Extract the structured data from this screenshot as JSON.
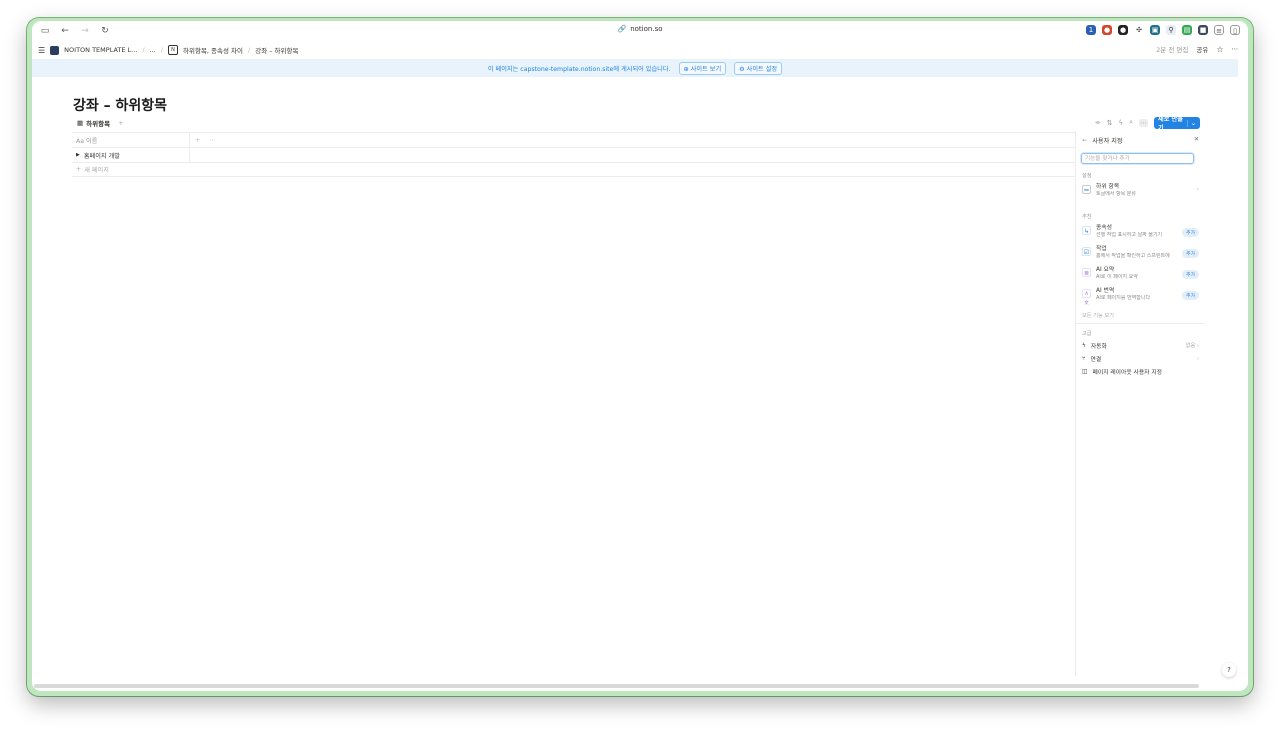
{
  "browser": {
    "url": "notion.so",
    "url_icon": "link-icon"
  },
  "header": {
    "workspace": "NOITON TEMPLATE L...",
    "ellipsis": "...",
    "crumb_parent": "하위항목, 종속성 차이",
    "crumb_current": "강좌 – 하위항목",
    "edited": "2분 전 편집",
    "share": "공유"
  },
  "banner": {
    "text": "이 페이지는 capstone-template.notion.site에 게시되어 있습니다.",
    "view_site": "사이트 보기",
    "site_settings": "사이트 설정"
  },
  "page": {
    "title": "강좌 – 하위항목",
    "view_tab": "하위항목",
    "add_view": "+",
    "new_button": "새로 만들기"
  },
  "table": {
    "name_header": "Aa 이름",
    "rows": [
      "홈페이지 개발"
    ],
    "new_page": "새 페이지"
  },
  "panel": {
    "title": "사용자 지정",
    "search_placeholder": "기능을 찾거나 추가",
    "section_settings": "설정",
    "subitems": {
      "title": "하위 항목",
      "desc": "토글에서 항목 분류"
    },
    "section_suggested": "추천",
    "suggested": [
      {
        "title": "종속성",
        "desc": "선행 작업 표시하고 날짜 옮기기",
        "add": "추가",
        "icon": "dependency-icon",
        "color": "#2383e2"
      },
      {
        "title": "작업",
        "desc": "홈에서 작업을 확인하고 스프린트에",
        "add": "추가",
        "icon": "checkbox-icon",
        "color": "#2383e2"
      },
      {
        "title": "AI 요약",
        "desc": "AI로 이 페이지 요약",
        "add": "추가",
        "icon": "ai-summary-icon",
        "color": "#9a6dd7"
      },
      {
        "title": "AI 번역",
        "desc": "AI로 페이지를 번역합니다",
        "add": "추가",
        "icon": "ai-translate-icon",
        "color": "#9a6dd7"
      }
    ],
    "more_features": "모든 기능 보기",
    "section_advanced": "고급",
    "automation": {
      "label": "자동화",
      "value": "없음"
    },
    "connections": {
      "label": "연결"
    },
    "layout": {
      "label": "페이지 레이아웃 사용자 지정"
    }
  }
}
